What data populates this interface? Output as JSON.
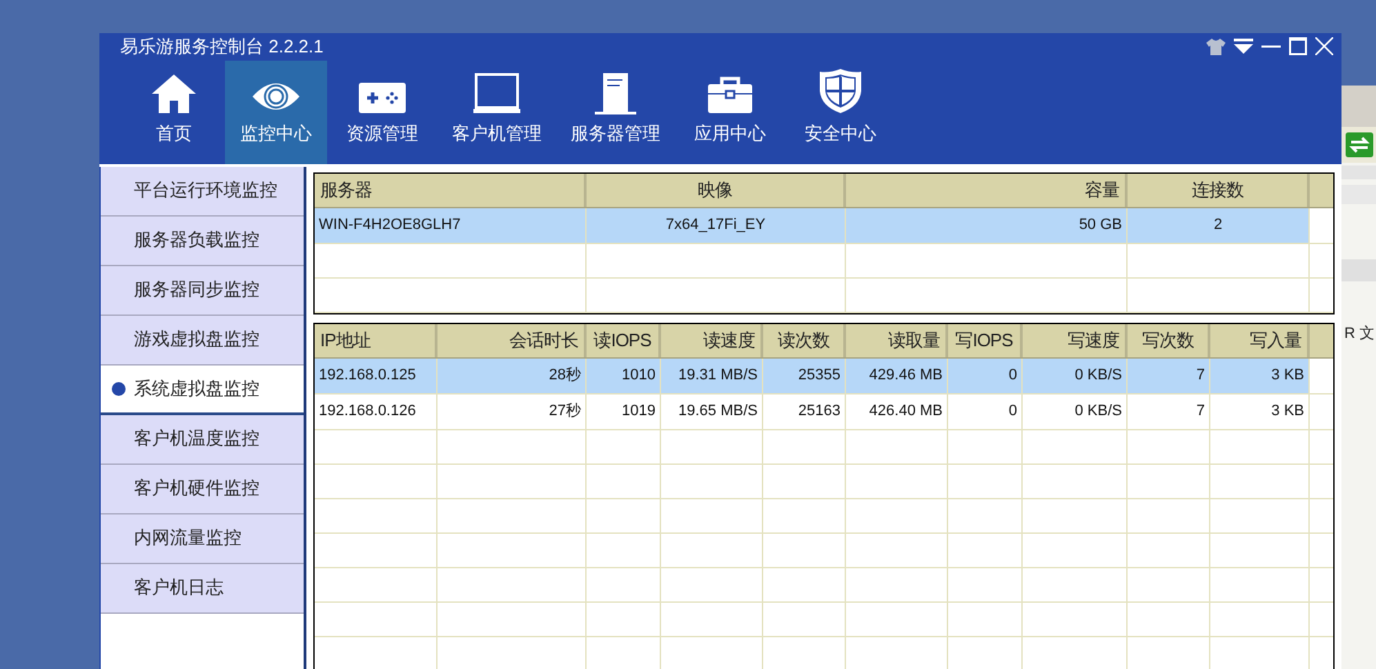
{
  "window": {
    "title": "易乐游服务控制台 2.2.2.1"
  },
  "nav": [
    {
      "label": "首页",
      "kind": "home",
      "selected": false
    },
    {
      "label": "监控中心",
      "kind": "eye",
      "selected": true
    },
    {
      "label": "资源管理",
      "kind": "gamepad",
      "selected": false
    },
    {
      "label": "客户机管理",
      "kind": "monitor",
      "selected": false
    },
    {
      "label": "服务器管理",
      "kind": "server",
      "selected": false
    },
    {
      "label": "应用中心",
      "kind": "toolbox",
      "selected": false
    },
    {
      "label": "安全中心",
      "kind": "shield",
      "selected": false
    }
  ],
  "sidebar": {
    "items": [
      {
        "label": "平台运行环境监控",
        "selected": false
      },
      {
        "label": "服务器负载监控",
        "selected": false
      },
      {
        "label": "服务器同步监控",
        "selected": false
      },
      {
        "label": "游戏虚拟盘监控",
        "selected": false
      },
      {
        "label": "系统虚拟盘监控",
        "selected": true
      },
      {
        "label": "客户机温度监控",
        "selected": false
      },
      {
        "label": "客户机硬件监控",
        "selected": false
      },
      {
        "label": "内网流量监控",
        "selected": false
      },
      {
        "label": "客户机日志",
        "selected": false
      }
    ]
  },
  "server_table": {
    "columns": [
      "服务器",
      "映像",
      "容量",
      "连接数"
    ],
    "rows": [
      {
        "cells": [
          "WIN-F4H2OE8GLH7",
          "7x64_17Fi_EY",
          "50 GB",
          "2"
        ],
        "selected": true
      }
    ]
  },
  "client_table": {
    "columns": [
      "IP地址",
      "会话时长",
      "读IOPS",
      "读速度",
      "读次数",
      "读取量",
      "写IOPS",
      "写速度",
      "写次数",
      "写入量"
    ],
    "rows": [
      {
        "cells": [
          "192.168.0.125",
          "28秒",
          "1010",
          "19.31 MB/S",
          "25355",
          "429.46 MB",
          "0",
          "0 KB/S",
          "7",
          "3 KB"
        ],
        "selected": true
      },
      {
        "cells": [
          "192.168.0.126",
          "27秒",
          "1019",
          "19.65 MB/S",
          "25163",
          "426.40 MB",
          "0",
          "0 KB/S",
          "7",
          "3 KB"
        ],
        "selected": false
      }
    ]
  },
  "background_window": {
    "text": "R 文"
  }
}
